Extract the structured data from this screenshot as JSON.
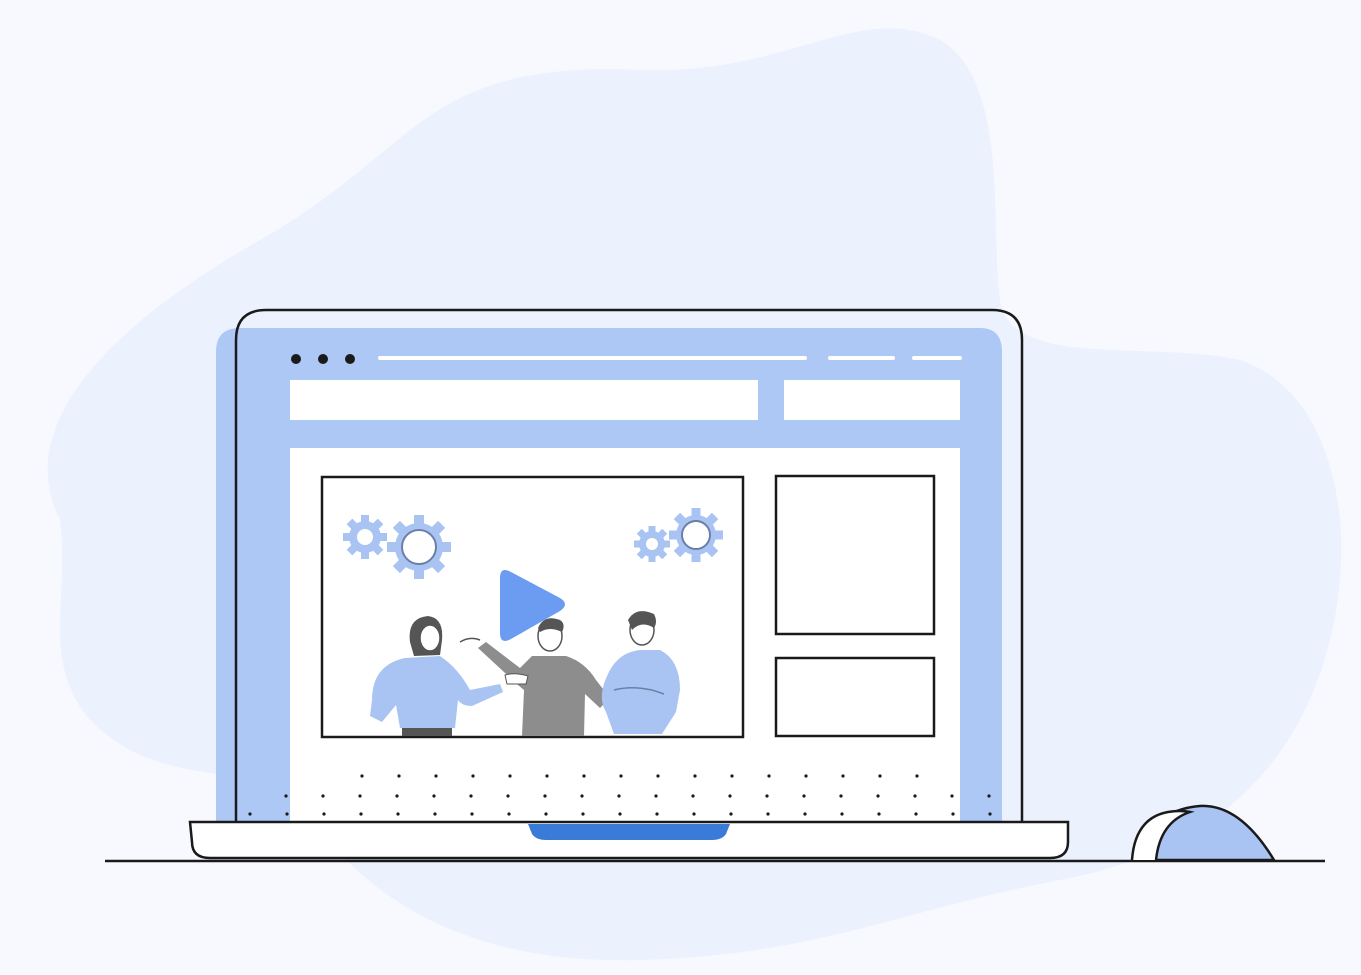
{
  "colors": {
    "page_background": "#f7f9fe",
    "background_blob": "#ebf1fd",
    "screen_frame_fill": "#adc8f4",
    "outline": "#1a1a1a",
    "white": "#ffffff",
    "accent_blue": "#6b9cf2",
    "light_blue_figure": "#a9c4f3",
    "gray_figure": "#8d8d8d",
    "hinge_blue": "#3b7bd8"
  },
  "icons": {
    "play": "play-icon",
    "gears": "gear-icon",
    "window_controls": "window-dots-icon",
    "mouse": "mouse-icon"
  }
}
